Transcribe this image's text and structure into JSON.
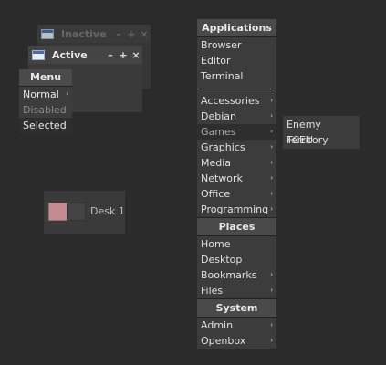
{
  "windows": {
    "inactive": {
      "title": "Inactive",
      "buttons": [
        "–",
        "+",
        "×"
      ]
    },
    "active": {
      "title": "Active",
      "buttons": [
        "–",
        "+",
        "×"
      ]
    }
  },
  "small_menu": {
    "header": "Menu",
    "items": [
      {
        "label": "Normal",
        "state": "normal",
        "has_submenu": true
      },
      {
        "label": "Disabled",
        "state": "disabled"
      },
      {
        "label": "Selected",
        "state": "selected"
      }
    ]
  },
  "pager": {
    "label": "Desk 1"
  },
  "applications_menu": {
    "header": "Applications",
    "items_top": [
      "Browser",
      "Editor",
      "Terminal"
    ],
    "items": [
      {
        "label": "Accessories",
        "arrow": "›"
      },
      {
        "label": "Debian",
        "arrow": "›"
      },
      {
        "label": "Games",
        "arrow": "›"
      },
      {
        "label": "Graphics",
        "arrow": "›"
      },
      {
        "label": "Media",
        "arrow": "›"
      },
      {
        "label": "Network",
        "arrow": "›"
      },
      {
        "label": "Office",
        "arrow": "›"
      },
      {
        "label": "Programming",
        "arrow": "›"
      }
    ]
  },
  "games_submenu": {
    "items": [
      "Enemy Territory",
      "FCEU"
    ]
  },
  "places_menu": {
    "header": "Places",
    "items": [
      {
        "label": "Home",
        "arrow": ""
      },
      {
        "label": "Desktop",
        "arrow": ""
      },
      {
        "label": "Bookmarks",
        "arrow": "›"
      },
      {
        "label": "Files",
        "arrow": "›"
      }
    ]
  },
  "system_menu": {
    "header": "System",
    "items": [
      {
        "label": "Admin",
        "arrow": "›"
      },
      {
        "label": "Openbox",
        "arrow": "›"
      }
    ]
  },
  "colors": {
    "background": "#2b2b2b",
    "menu_bg": "#3c3c3c",
    "header_bg": "#4a4a4a",
    "desk_active": "#c48a92"
  }
}
